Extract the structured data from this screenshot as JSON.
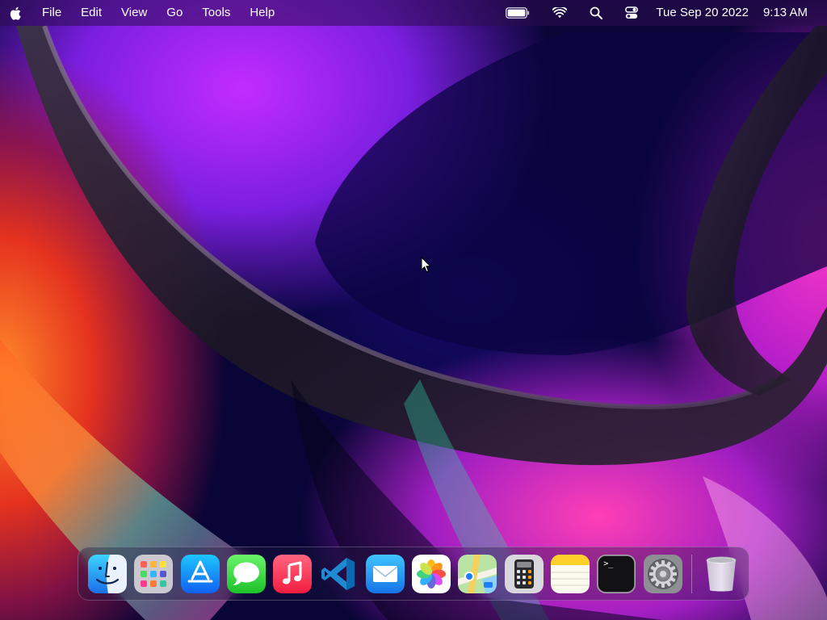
{
  "menubar": {
    "apple_icon": "apple-logo-icon",
    "menus": [
      {
        "id": "file",
        "label": "File"
      },
      {
        "id": "edit",
        "label": "Edit"
      },
      {
        "id": "view",
        "label": "View"
      },
      {
        "id": "go",
        "label": "Go"
      },
      {
        "id": "tools",
        "label": "Tools"
      },
      {
        "id": "help",
        "label": "Help"
      }
    ],
    "status_icons": [
      "battery-icon",
      "wifi-icon",
      "search-icon",
      "control-center-icon"
    ],
    "date": "Tue Sep 20 2022",
    "time": "9:13 AM"
  },
  "dock": {
    "apps": [
      {
        "id": "finder",
        "icon": "finder-icon"
      },
      {
        "id": "launchpad",
        "icon": "launchpad-icon"
      },
      {
        "id": "app-store",
        "icon": "app-store-icon"
      },
      {
        "id": "messages",
        "icon": "messages-icon"
      },
      {
        "id": "music",
        "icon": "music-icon"
      },
      {
        "id": "vscode",
        "icon": "vscode-icon"
      },
      {
        "id": "mail",
        "icon": "mail-icon"
      },
      {
        "id": "photos",
        "icon": "photos-icon"
      },
      {
        "id": "maps",
        "icon": "maps-icon"
      },
      {
        "id": "calculator",
        "icon": "calculator-icon"
      },
      {
        "id": "notes",
        "icon": "notes-icon"
      },
      {
        "id": "terminal",
        "icon": "terminal-icon"
      },
      {
        "id": "system-preferences",
        "icon": "gear-icon"
      }
    ],
    "trash": {
      "id": "trash",
      "icon": "trash-icon"
    },
    "terminal_prompt": ">_"
  },
  "colors": {
    "menubar_text": "#ffffff",
    "accent_purple": "#7a1ee0",
    "accent_pink": "#f535c8",
    "accent_orange": "#ff8a2a"
  }
}
